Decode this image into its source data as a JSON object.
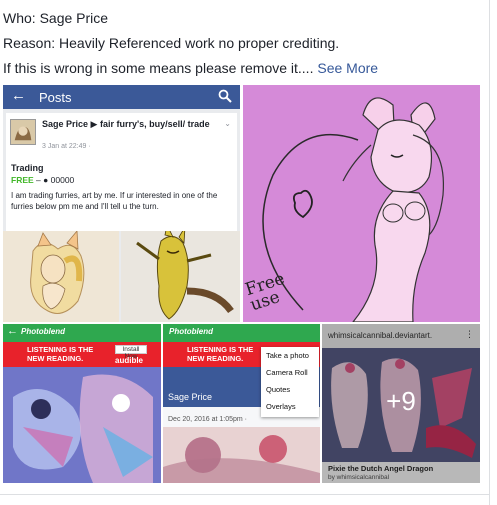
{
  "post": {
    "line1": "Who: Sage Price",
    "line2": "Reason: Heavily Referenced work no proper crediting.",
    "line3": "If this is wrong in some means please remove it....",
    "see_more": "See More"
  },
  "tile1": {
    "bar_title": "Posts",
    "back_icon": "arrow-left-icon",
    "search_icon": "search-icon",
    "author": "Sage Price ▶ fair furry's, buy/sell/ trade",
    "meta": "3 Jan at 22:49 ·",
    "item_title": "Trading",
    "price_free": "FREE",
    "price_rest": "– ● 00000",
    "body": "I am trading furries, art by me. If ur interested in one of the furries below pm me and I'll tell u the turn."
  },
  "tile2": {
    "handwriting": "Free use"
  },
  "tile3": {
    "app_name": "Photoblend",
    "ad_text": "LISTENING IS THE NEW READING.",
    "ad_button": "Install Now",
    "ad_brand": "audible"
  },
  "tile4": {
    "app_name": "Photoblend",
    "ad_text": "LISTENING IS THE NEW READING.",
    "sage_title": "Sage Price",
    "date": "Dec 20, 2016 at 1:05pm ·",
    "menu": [
      "Take a photo",
      "Camera Roll",
      "Quotes",
      "Overlays"
    ]
  },
  "tile5": {
    "url": "whimsicalcannibal.deviantart.",
    "caption": "Pixie the Dutch Angel Dragon",
    "byline": "by whimsicalcannibal",
    "more_count": "+9"
  },
  "colors": {
    "fb_blue": "#3b5998",
    "link": "#365899",
    "photoblend_green": "#2fa84f",
    "ad_red": "#e8222b",
    "pink_bg": "#d58ad8"
  }
}
